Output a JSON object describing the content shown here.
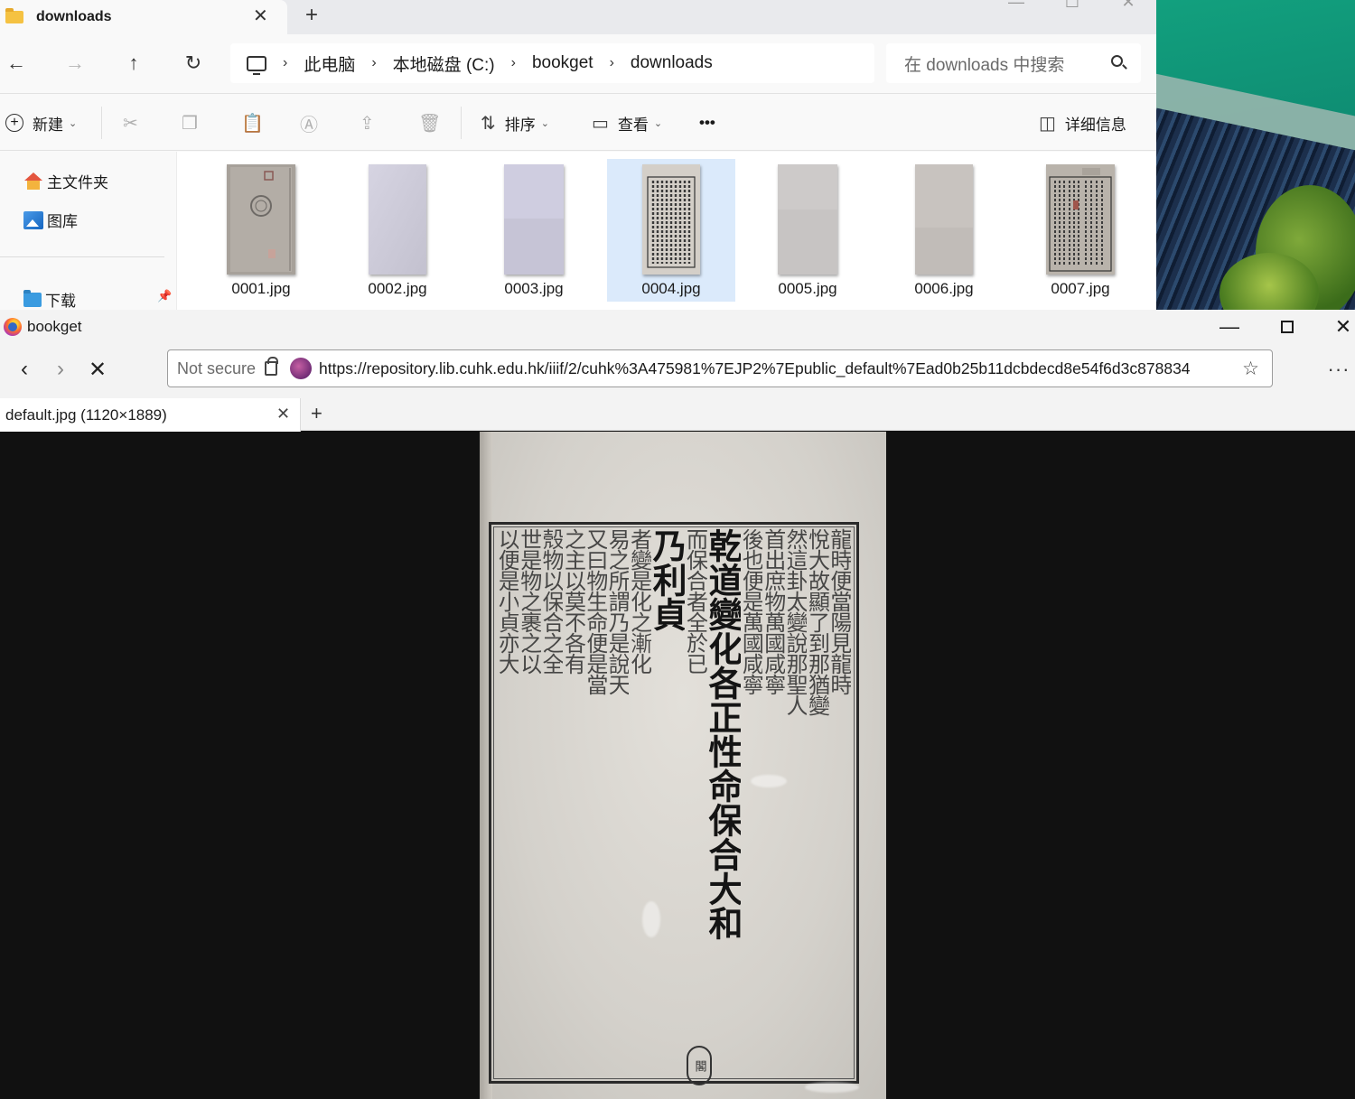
{
  "explorer": {
    "tab_title": "downloads",
    "tab_close": "✕",
    "new_tab": "+",
    "window_controls": [
      "—",
      "☐",
      "✕"
    ],
    "nav": {
      "back": "←",
      "forward": "→",
      "up": "↑",
      "refresh": "↻"
    },
    "breadcrumb": [
      "此电脑",
      "本地磁盘 (C:)",
      "bookget",
      "downloads"
    ],
    "search_placeholder": "在 downloads 中搜索",
    "toolbar": {
      "new_label": "新建",
      "sort_label": "排序",
      "view_label": "查看",
      "more_label": "•••",
      "details_label": "详细信息"
    },
    "sidebar": {
      "home": "主文件夹",
      "gallery": "图库",
      "downloads": "下载"
    },
    "files": [
      {
        "name": "0001.jpg",
        "selected": false
      },
      {
        "name": "0002.jpg",
        "selected": false
      },
      {
        "name": "0003.jpg",
        "selected": false
      },
      {
        "name": "0004.jpg",
        "selected": true
      },
      {
        "name": "0005.jpg",
        "selected": false
      },
      {
        "name": "0006.jpg",
        "selected": false
      },
      {
        "name": "0007.jpg",
        "selected": false
      }
    ]
  },
  "browser": {
    "window_title": "bookget",
    "window_controls": [
      "—",
      "☐",
      "✕"
    ],
    "nav": {
      "back": "‹",
      "forward": "›",
      "stop": "✕"
    },
    "not_secure": "Not secure",
    "url": "https://repository.lib.cuhk.edu.hk/iiif/2/cuhk%3A475981%7EJP2%7Epublic_default%7Ead0b25b11dcbdecd8e54f6d3c878834",
    "star": "☆",
    "menu": "···",
    "tab_title": "default.jpg (1120×1889)",
    "tab_close": "✕",
    "new_tab": "+"
  },
  "scan": {
    "columns": [
      "龍時便當陽見龍時",
      "悅大故顯了到那猶變",
      "然這卦太變說那聖人",
      "首出庶物萬國咸寧",
      "後也便是萬國咸寧",
      "乃利貞",
      "而保合者全於已",
      "者變是化之漸化",
      "易之所謂乃是說天",
      "又曰物生命便是當",
      "之主以莫不各有",
      "殼物以保合之全",
      "世是物之裹之以",
      "以便是小貞亦大"
    ],
    "heading": "乾道變化各正性命保合大和",
    "stamp": "閣"
  }
}
